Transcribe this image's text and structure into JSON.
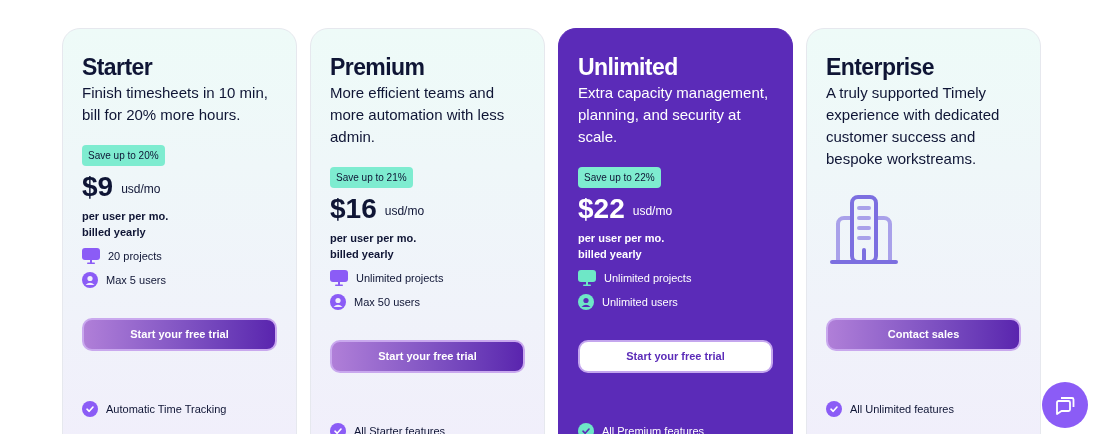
{
  "plans": [
    {
      "kind": "price",
      "highlighted": false,
      "name": "Starter",
      "description": "Finish timesheets in 10 min, bill for 20% more hours.",
      "badge": "Save up to 20%",
      "price": "$9",
      "unit": "usd/mo",
      "billing": [
        "per user per mo.",
        "billed yearly"
      ],
      "limits": [
        "20 projects",
        "Max 5 users"
      ],
      "button": "Start your free trial",
      "features": [
        "Automatic Time Tracking"
      ]
    },
    {
      "kind": "price",
      "highlighted": false,
      "name": "Premium",
      "description": "More efficient teams and more automation with less admin.",
      "badge": "Save up to 21%",
      "price": "$16",
      "unit": "usd/mo",
      "billing": [
        "per user per mo.",
        "billed yearly"
      ],
      "limits": [
        "Unlimited projects",
        "Max 50 users"
      ],
      "button": "Start your free trial",
      "features": [
        "All Starter features"
      ]
    },
    {
      "kind": "price",
      "highlighted": true,
      "name": "Unlimited",
      "description": "Extra capacity management, planning, and security at scale.",
      "badge": "Save up to 22%",
      "price": "$22",
      "unit": "usd/mo",
      "billing": [
        "per user per mo.",
        "billed yearly"
      ],
      "limits": [
        "Unlimited projects",
        "Unlimited users"
      ],
      "button": "Start your free trial",
      "features": [
        "All Premium features"
      ]
    },
    {
      "kind": "contact",
      "highlighted": false,
      "name": "Enterprise",
      "description": "A truly supported Timely experience with dedicated customer success and bespoke workstreams.",
      "button": "Contact sales",
      "features": [
        "All Unlimited features"
      ]
    }
  ]
}
